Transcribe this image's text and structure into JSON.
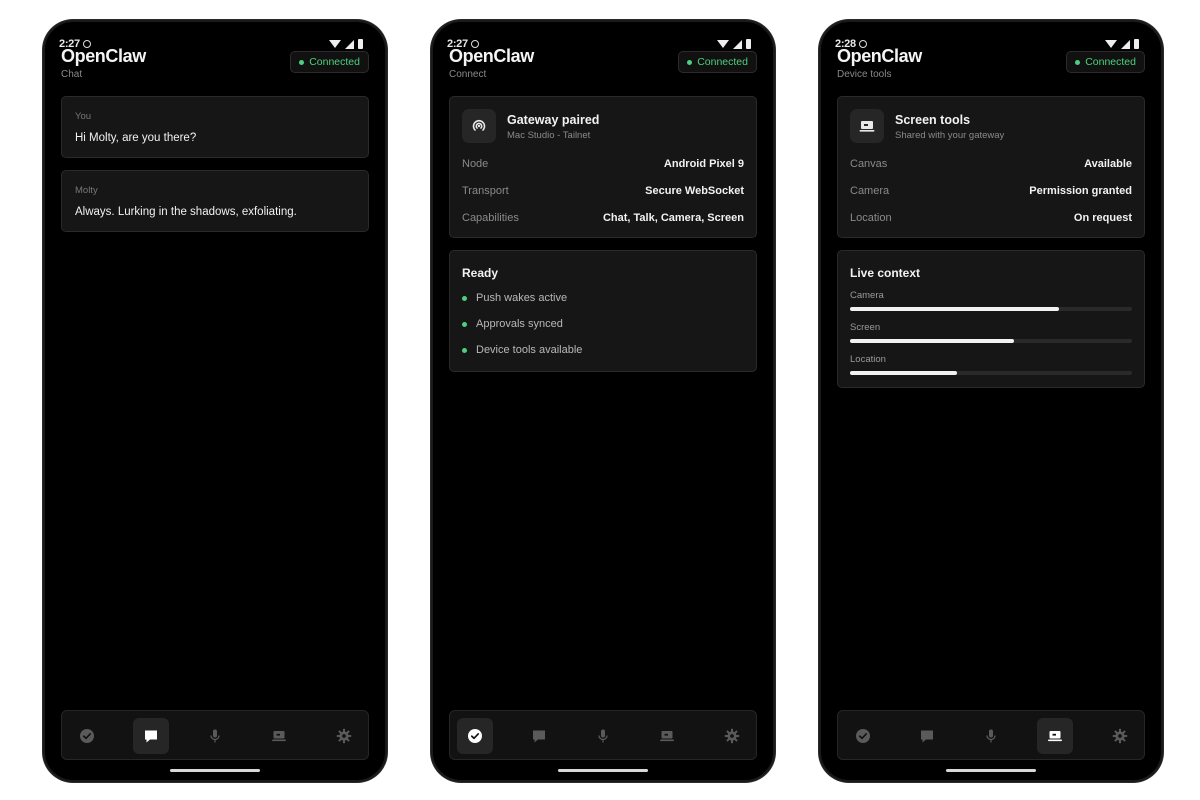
{
  "app": {
    "title": "OpenClaw",
    "connected_label": "Connected",
    "accent": "#4cd07d"
  },
  "phones": [
    {
      "time": "2:27",
      "subtitle": "Chat",
      "messages": [
        {
          "sender": "You",
          "text": "Hi Molty, are you there?"
        },
        {
          "sender": "Molty",
          "text": "Always. Lurking in the shadows, exfoliating."
        }
      ]
    },
    {
      "time": "2:27",
      "subtitle": "Connect",
      "gateway": {
        "title": "Gateway paired",
        "subtitle": "Mac Studio - Tailnet",
        "rows": [
          {
            "key": "Node",
            "value": "Android Pixel 9"
          },
          {
            "key": "Transport",
            "value": "Secure WebSocket"
          },
          {
            "key": "Capabilities",
            "value": "Chat, Talk, Camera, Screen"
          }
        ]
      },
      "ready": {
        "title": "Ready",
        "items": [
          "Push wakes active",
          "Approvals synced",
          "Device tools available"
        ]
      }
    },
    {
      "time": "2:28",
      "subtitle": "Device tools",
      "tools": {
        "title": "Screen tools",
        "subtitle": "Shared with your gateway",
        "rows": [
          {
            "key": "Canvas",
            "value": "Available"
          },
          {
            "key": "Camera",
            "value": "Permission granted"
          },
          {
            "key": "Location",
            "value": "On request"
          }
        ]
      },
      "live": {
        "title": "Live context",
        "bars": [
          {
            "label": "Camera",
            "fraction": 0.74
          },
          {
            "label": "Screen",
            "fraction": 0.58
          },
          {
            "label": "Location",
            "fraction": 0.38
          }
        ]
      }
    }
  ],
  "nav": {
    "items": [
      {
        "name": "connect",
        "icon": "check-circle-icon"
      },
      {
        "name": "chat",
        "icon": "chat-icon"
      },
      {
        "name": "talk",
        "icon": "mic-icon"
      },
      {
        "name": "device-tools",
        "icon": "laptop-icon"
      },
      {
        "name": "settings",
        "icon": "gear-icon"
      }
    ],
    "active_by_phone": [
      1,
      0,
      3
    ]
  }
}
